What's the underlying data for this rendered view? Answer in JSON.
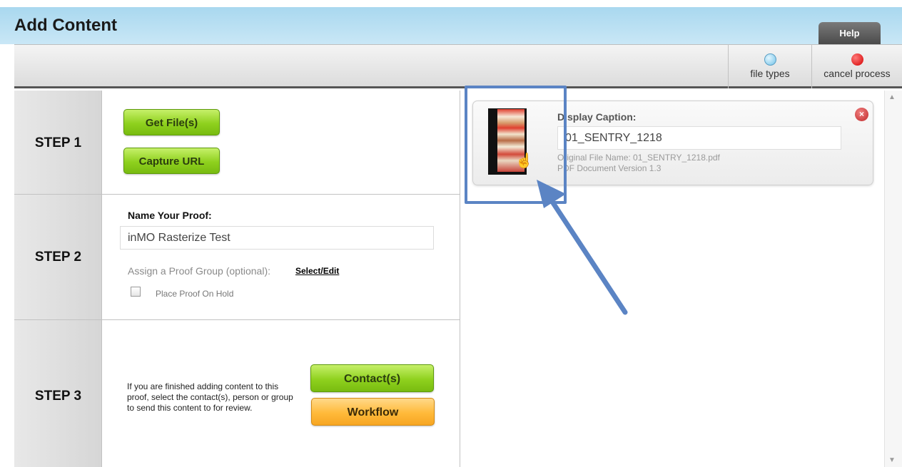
{
  "window": {
    "title": "Add Content",
    "help_label": "Help"
  },
  "toolbar": {
    "file_types": {
      "label": "file types",
      "color": "#72c3e8"
    },
    "cancel_process": {
      "label": "cancel process",
      "color": "#d40000"
    }
  },
  "steps": {
    "step1": {
      "label": "STEP 1",
      "get_files": "Get File(s)",
      "capture_url": "Capture URL"
    },
    "step2": {
      "label": "STEP 2",
      "name_label": "Name Your Proof:",
      "name_value": "inMO Rasterize Test",
      "assign_label": "Assign a Proof Group (optional):",
      "select_edit": "Select/Edit",
      "hold_label": "Place Proof On Hold",
      "hold_checked": false
    },
    "step3": {
      "label": "STEP 3",
      "instructions": "If you are finished adding content to this proof, select the contact(s), person or group to send this content to for review.",
      "contacts_button": "Contact(s)",
      "workflow_button": "Workflow"
    }
  },
  "content_item": {
    "caption_label": "Display Caption:",
    "caption_value": "01_SENTRY_1218",
    "original_file": "Original File Name: 01_SENTRY_1218.pdf",
    "doc_version": "PDF Document Version 1.3"
  },
  "icons": {
    "close": "×",
    "pointer": "☝",
    "scroll_up": "▲",
    "scroll_down": "▼"
  },
  "colors": {
    "highlight": "#5b84c4",
    "accent_green": "#8fd11e",
    "accent_orange": "#ffba3a"
  }
}
